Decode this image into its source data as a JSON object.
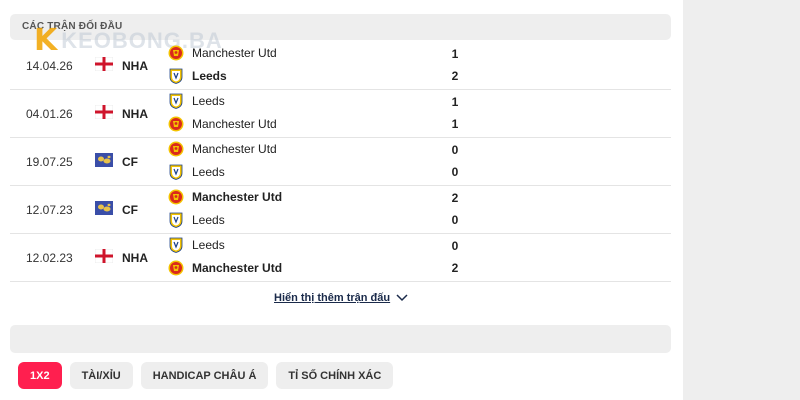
{
  "section_title": "CÁC TRẬN ĐỐI ĐẦU",
  "watermark": {
    "letter": "K",
    "text": "KEOBONG.BA"
  },
  "matches": [
    {
      "date": "14.04.26",
      "competition": "NHA",
      "flag": "england-flag",
      "home": {
        "name": "Manchester Utd",
        "crest": "man-utd-crest",
        "bold": false
      },
      "away": {
        "name": "Leeds",
        "crest": "leeds-crest",
        "bold": true
      },
      "home_score": "1",
      "away_score": "2"
    },
    {
      "date": "04.01.26",
      "competition": "NHA",
      "flag": "england-flag",
      "home": {
        "name": "Leeds",
        "crest": "leeds-crest",
        "bold": false
      },
      "away": {
        "name": "Manchester Utd",
        "crest": "man-utd-crest",
        "bold": false
      },
      "home_score": "1",
      "away_score": "1"
    },
    {
      "date": "19.07.25",
      "competition": "CF",
      "flag": "world-flag",
      "home": {
        "name": "Manchester Utd",
        "crest": "man-utd-crest",
        "bold": false
      },
      "away": {
        "name": "Leeds",
        "crest": "leeds-crest",
        "bold": false
      },
      "home_score": "0",
      "away_score": "0"
    },
    {
      "date": "12.07.23",
      "competition": "CF",
      "flag": "world-flag",
      "home": {
        "name": "Manchester Utd",
        "crest": "man-utd-crest",
        "bold": true
      },
      "away": {
        "name": "Leeds",
        "crest": "leeds-crest",
        "bold": false
      },
      "home_score": "2",
      "away_score": "0"
    },
    {
      "date": "12.02.23",
      "competition": "NHA",
      "flag": "england-flag",
      "home": {
        "name": "Leeds",
        "crest": "leeds-crest",
        "bold": false
      },
      "away": {
        "name": "Manchester Utd",
        "crest": "man-utd-crest",
        "bold": true
      },
      "home_score": "0",
      "away_score": "2"
    }
  ],
  "show_more_label": "Hiển thị thêm trận đấu",
  "tabs": [
    {
      "label": "1X2",
      "active": true
    },
    {
      "label": "TÀI/XỈU",
      "active": false
    },
    {
      "label": "HANDICAP CHÂU Á",
      "active": false
    },
    {
      "label": "TỈ SỐ CHÍNH XÁC",
      "active": false
    }
  ],
  "colors": {
    "accent": "#ff1f4f",
    "panel": "#eeeeee",
    "man_utd_red": "#da291c",
    "leeds_yellow": "#f4c300"
  }
}
